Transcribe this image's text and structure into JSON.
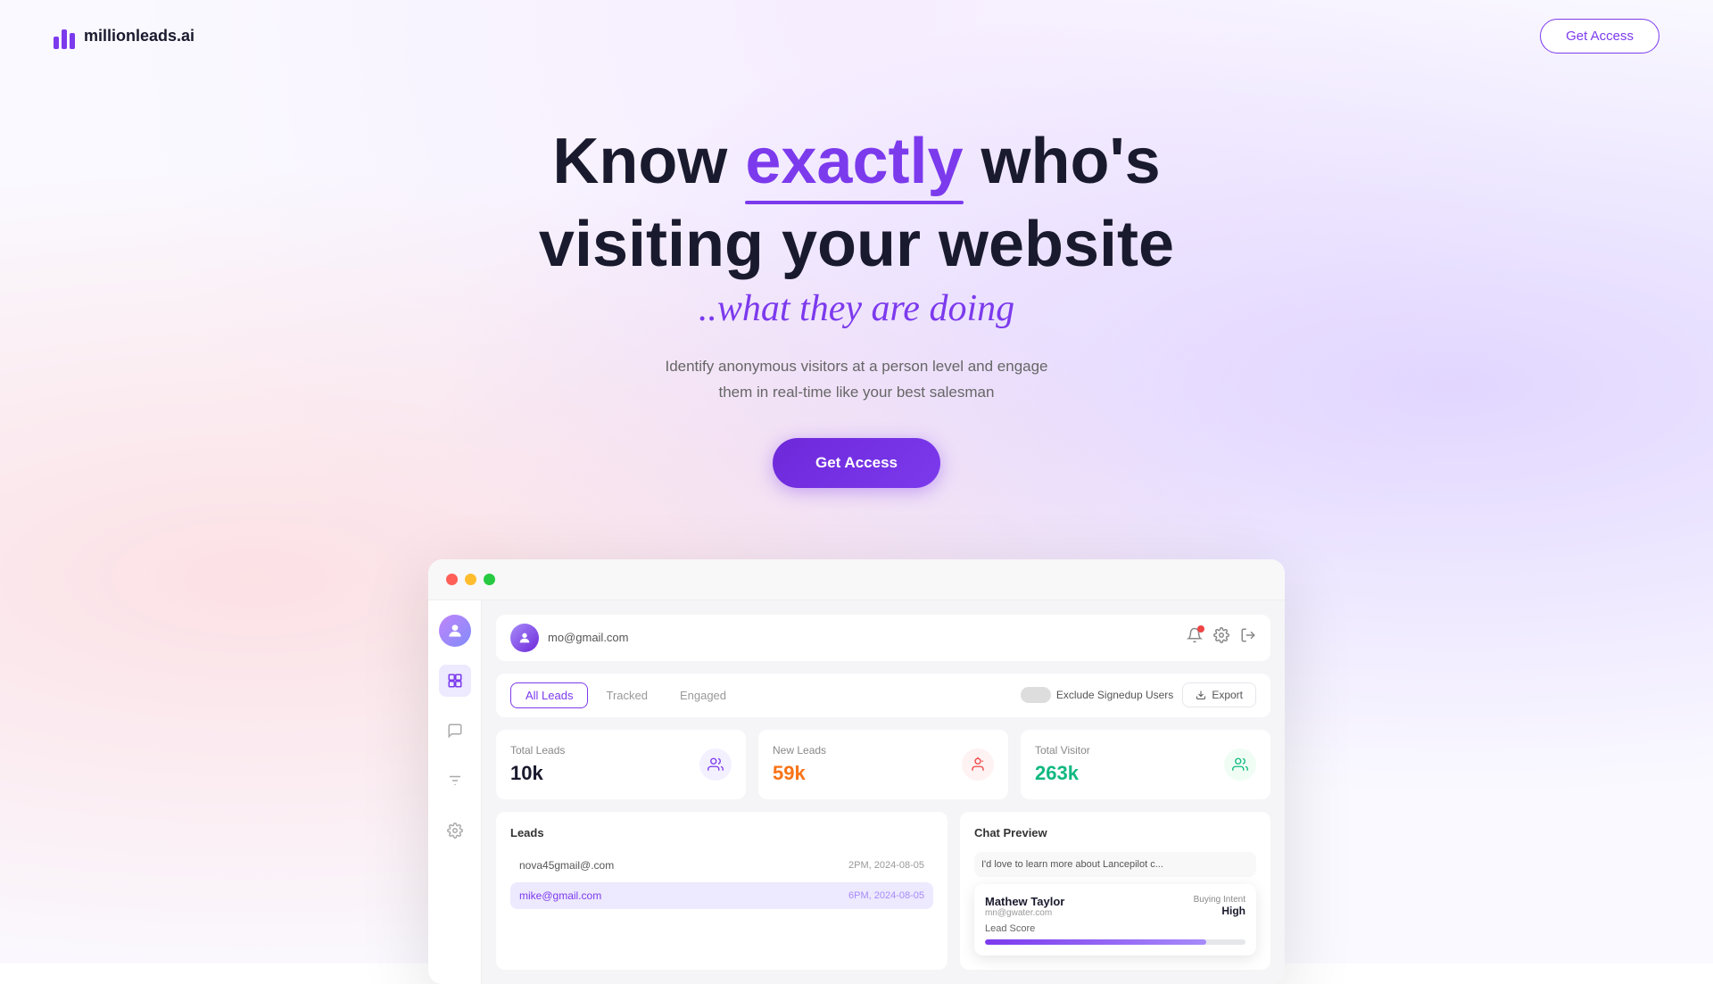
{
  "logo": {
    "text": "millionleads.ai"
  },
  "header": {
    "get_access_label": "Get Access"
  },
  "hero": {
    "title_part1": "Know ",
    "title_highlight": "exactly",
    "title_part2": " who's",
    "title_line2": "visiting your website",
    "cursive_text": "..what they are doing",
    "description_line1": "Identify anonymous visitors at a person level and engage",
    "description_line2": "them in real-time like your best salesman",
    "cta_label": "Get Access"
  },
  "dashboard": {
    "user_email": "mo@gmail.com",
    "tabs": [
      {
        "label": "All Leads",
        "active": true
      },
      {
        "label": "Tracked",
        "active": false
      },
      {
        "label": "Engaged",
        "active": false
      }
    ],
    "exclude_label": "Exclude Signedup Users",
    "export_label": "Export",
    "stats": [
      {
        "label": "Total Leads",
        "value": "10k",
        "color": "dark",
        "icon": "👥"
      },
      {
        "label": "New Leads",
        "value": "59k",
        "color": "orange",
        "icon": "👤"
      },
      {
        "label": "Total Visitor",
        "value": "263k",
        "color": "green",
        "icon": "👥"
      }
    ],
    "leads_panel": {
      "title": "Leads",
      "items": [
        {
          "email": "nova45gmail@.com",
          "time": "2PM, 2024-08-05",
          "highlighted": false
        },
        {
          "email": "mike@gmail.com",
          "time": "6PM, 2024-08-05",
          "highlighted": true
        }
      ]
    },
    "chat_panel": {
      "title": "Chat Preview",
      "message": "I'd love to learn more about Lancepilot c..."
    },
    "contact_card": {
      "name": "Mathew Taylor",
      "email": "mn@gwater.com",
      "buying_intent_label": "Buying Intent",
      "buying_intent_value": "High",
      "lead_score_label": "Lead Score",
      "lead_score_pct": 85
    }
  }
}
